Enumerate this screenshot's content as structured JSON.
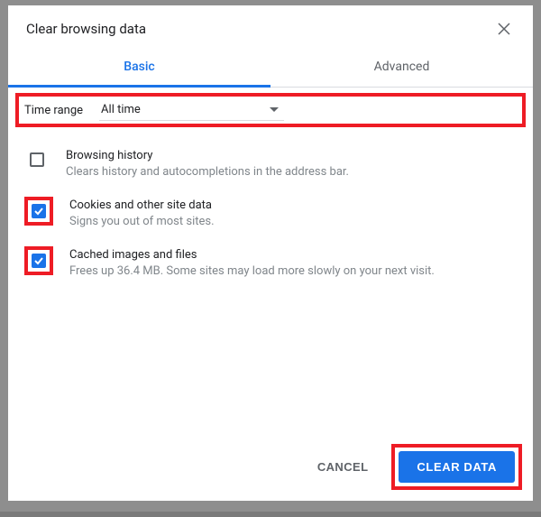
{
  "dialog": {
    "title": "Clear browsing data",
    "close_label": "Close"
  },
  "tabs": {
    "basic": "Basic",
    "advanced": "Advanced"
  },
  "time_range": {
    "label": "Time range",
    "value": "All time"
  },
  "options": [
    {
      "title": "Browsing history",
      "desc": "Clears history and autocompletions in the address bar.",
      "checked": false,
      "framed": false
    },
    {
      "title": "Cookies and other site data",
      "desc": "Signs you out of most sites.",
      "checked": true,
      "framed": true
    },
    {
      "title": "Cached images and files",
      "desc": "Frees up 36.4 MB. Some sites may load more slowly on your next visit.",
      "checked": true,
      "framed": true
    }
  ],
  "footer": {
    "cancel": "CANCEL",
    "confirm": "CLEAR DATA"
  }
}
